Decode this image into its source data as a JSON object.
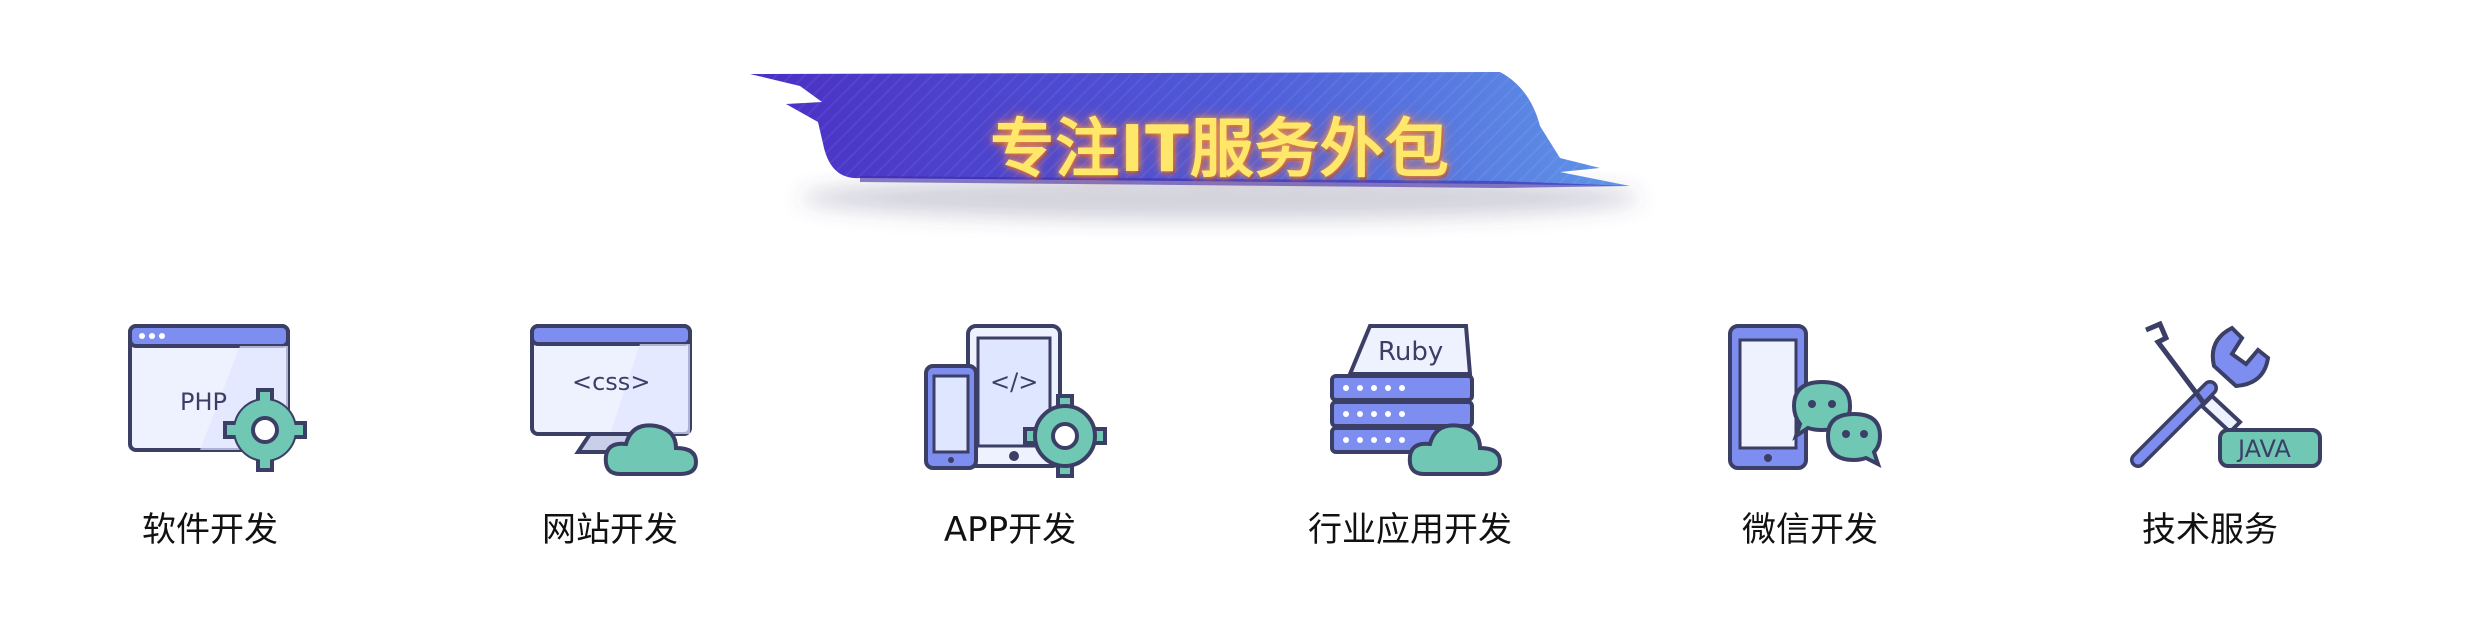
{
  "banner": {
    "title": "专注IT服务外包"
  },
  "services": [
    {
      "label": "软件开发",
      "icon": "php-window-gear-icon",
      "icon_text": "PHP"
    },
    {
      "label": "网站开发",
      "icon": "css-monitor-cloud-icon",
      "icon_text": "<css>"
    },
    {
      "label": "APP开发",
      "icon": "mobile-tablet-code-gear-icon",
      "icon_text": "</>"
    },
    {
      "label": "行业应用开发",
      "icon": "ruby-server-cloud-icon",
      "icon_text": "Ruby"
    },
    {
      "label": "微信开发",
      "icon": "phone-wechat-icon",
      "icon_text": ""
    },
    {
      "label": "技术服务",
      "icon": "java-tools-icon",
      "icon_text": "JAVA"
    }
  ],
  "colors": {
    "banner_dark": "#4a34c8",
    "banner_light": "#5d8ee6",
    "title_yellow": "#ffe76a",
    "icon_outline": "#3b3f66",
    "icon_blue": "#7d8ef0",
    "icon_light": "#eaf0ff",
    "icon_teal": "#6fc7b4"
  }
}
